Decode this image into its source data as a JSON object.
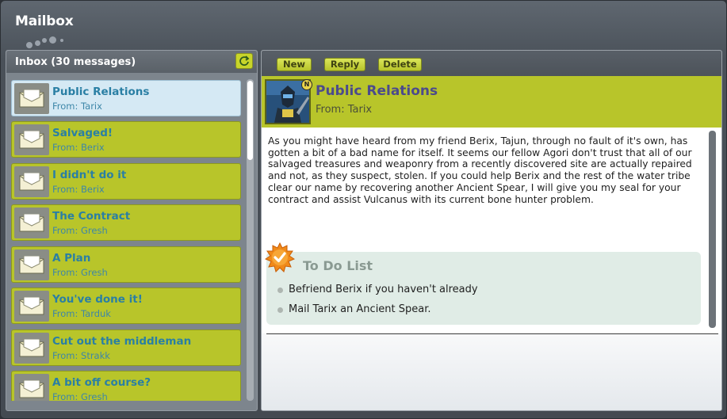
{
  "window": {
    "title": "Mailbox"
  },
  "inbox": {
    "title": "Inbox (30 messages)",
    "messages": [
      {
        "subject": "Public Relations",
        "from": "From: Tarix",
        "selected": true
      },
      {
        "subject": "Salvaged!",
        "from": "From: Berix",
        "selected": false
      },
      {
        "subject": "I didn't do it",
        "from": "From: Berix",
        "selected": false
      },
      {
        "subject": "The Contract",
        "from": "From: Gresh",
        "selected": false
      },
      {
        "subject": "A Plan",
        "from": "From: Gresh",
        "selected": false
      },
      {
        "subject": "You've done it!",
        "from": "From: Tarduk",
        "selected": false
      },
      {
        "subject": "Cut out the middleman",
        "from": "From: Strakk",
        "selected": false
      },
      {
        "subject": "A bit off course?",
        "from": "From: Gresh",
        "selected": false
      }
    ]
  },
  "toolbar": {
    "new_label": "New",
    "reply_label": "Reply",
    "delete_label": "Delete"
  },
  "message": {
    "badge": "N",
    "subject": "Public Relations",
    "from": "From: Tarix",
    "body": "As you might have heard from my friend Berix, Tajun, through no fault of it's own, has gotten a bit of a bad name for itself. It seems our fellow Agori don't trust that all of our salvaged treasures and weaponry from a recently discovered site are actually repaired and not, as they suspect, stolen. If you could help Berix and the rest of the water tribe clear our name by recovering another Ancient Spear, I will give you my seal for your contract and assist Vulcanus with its current bone hunter problem."
  },
  "todo": {
    "title": "To Do List",
    "items": [
      "Befriend Berix if you haven't already",
      "Mail Tarix an Ancient Spear."
    ]
  },
  "colors": {
    "accent_green": "#b8c52a",
    "selected_blue": "#d5e9f4",
    "subject_blue": "#2a7fa4",
    "title_purple": "#4b4a8c"
  }
}
